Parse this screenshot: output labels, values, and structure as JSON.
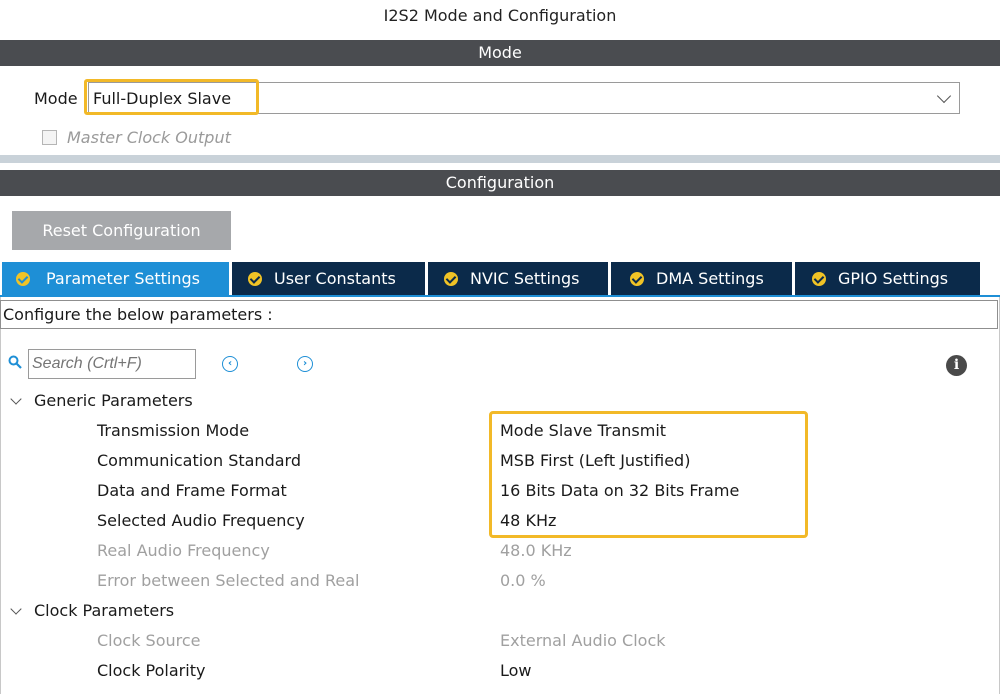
{
  "window": {
    "title": "I2S2 Mode and Configuration"
  },
  "mode_section": {
    "header": "Mode",
    "mode_label": "Mode",
    "mode_value": "Full-Duplex Slave",
    "master_clock_output_label": "Master Clock Output",
    "master_clock_output_checked": false
  },
  "config_section": {
    "header": "Configuration",
    "reset_button": "Reset Configuration"
  },
  "tabs": [
    {
      "label": "Parameter Settings",
      "active": true
    },
    {
      "label": "User Constants",
      "active": false
    },
    {
      "label": "NVIC Settings",
      "active": false
    },
    {
      "label": "DMA Settings",
      "active": false
    },
    {
      "label": "GPIO Settings",
      "active": false
    }
  ],
  "panel": {
    "configure_text": "Configure the below parameters :",
    "search_placeholder": "Search (Crtl+F)"
  },
  "groups": [
    {
      "name": "Generic Parameters",
      "expanded": true,
      "params": [
        {
          "name": "Transmission Mode",
          "value": "Mode Slave Transmit",
          "enabled": true
        },
        {
          "name": "Communication Standard",
          "value": "MSB First (Left Justified)",
          "enabled": true
        },
        {
          "name": "Data and Frame Format",
          "value": "16 Bits Data on 32 Bits Frame",
          "enabled": true
        },
        {
          "name": "Selected Audio Frequency",
          "value": "48 KHz",
          "enabled": true
        },
        {
          "name": "Real Audio Frequency",
          "value": "48.0 KHz",
          "enabled": false
        },
        {
          "name": "Error between Selected and Real",
          "value": "0.0 %",
          "enabled": false
        }
      ]
    },
    {
      "name": "Clock Parameters",
      "expanded": true,
      "params": [
        {
          "name": "Clock Source",
          "value": "External Audio Clock",
          "enabled": false
        },
        {
          "name": "Clock Polarity",
          "value": "Low",
          "enabled": true
        }
      ]
    }
  ],
  "colors": {
    "section_bar": "#4a4c50",
    "tab_active": "#1e8fd6",
    "tab_inactive": "#0b2a4a",
    "highlight": "#f2b928",
    "check_icon": "#f0c326"
  }
}
